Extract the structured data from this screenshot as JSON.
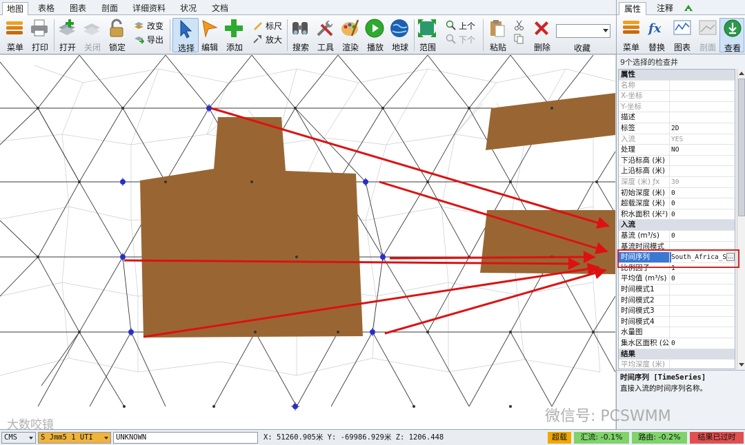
{
  "tabs": [
    "地图",
    "表格",
    "图表",
    "剖面",
    "详细资料",
    "状况",
    "文档"
  ],
  "active_tab": 0,
  "ribbon": {
    "menu": "菜单",
    "print": "打印",
    "open": "打开",
    "close": "关闭",
    "lock": "锁定",
    "change": "改变",
    "export": "导出",
    "select": "选择",
    "edit": "编辑",
    "add": "添加",
    "ruler": "标尺",
    "zoom": "放大",
    "search": "搜索",
    "tools": "工具",
    "render": "渲染",
    "play": "播放",
    "globe": "地球",
    "extent": "范围",
    "prev": "上个",
    "next": "下个",
    "paste": "粘贴",
    "delete": "删除",
    "favorites": "收藏",
    "favorites_value": ""
  },
  "panel": {
    "tab_properties": "属性",
    "tab_notes": "注释",
    "toolbar": {
      "menu": "菜单",
      "replace": "替换",
      "chart": "图表",
      "profile": "剖面",
      "inspect": "查看"
    },
    "caption": "9个选择的检查井",
    "rows": [
      {
        "k": "属性",
        "v": "",
        "type": "cat"
      },
      {
        "k": "名称",
        "v": "",
        "type": "dim"
      },
      {
        "k": "X-坐标",
        "v": "",
        "type": "dim"
      },
      {
        "k": "Y-坐标",
        "v": "",
        "type": "dim"
      },
      {
        "k": "描述",
        "v": "",
        "type": ""
      },
      {
        "k": "标签",
        "v": "2D",
        "type": ""
      },
      {
        "k": "入流",
        "v": "YES",
        "type": "dim"
      },
      {
        "k": "处理",
        "v": "NO",
        "type": ""
      },
      {
        "k": "下沿标高 (米)",
        "v": "",
        "type": ""
      },
      {
        "k": "上沿标高 (米)",
        "v": "",
        "type": ""
      },
      {
        "k": "深度 (米) ƒx",
        "v": "30",
        "type": "dim"
      },
      {
        "k": "初始深度 (米)",
        "v": "0",
        "type": ""
      },
      {
        "k": "超载深度 (米)",
        "v": "0",
        "type": ""
      },
      {
        "k": "积水面积 (米²)",
        "v": "0",
        "type": ""
      },
      {
        "k": "入流",
        "v": "",
        "type": "cat"
      },
      {
        "k": "基流 (m³/s)",
        "v": "0",
        "type": ""
      },
      {
        "k": "基流时间模式",
        "v": "",
        "type": ""
      },
      {
        "k": "时间序列",
        "v": "South_Africa_S",
        "type": "hl"
      },
      {
        "k": "比例因子",
        "v": "1",
        "type": ""
      },
      {
        "k": "平均值 (m³/s)",
        "v": "0",
        "type": ""
      },
      {
        "k": "时间模式1",
        "v": "",
        "type": ""
      },
      {
        "k": "时间模式2",
        "v": "",
        "type": ""
      },
      {
        "k": "时间模式3",
        "v": "",
        "type": ""
      },
      {
        "k": "时间模式4",
        "v": "",
        "type": ""
      },
      {
        "k": "水量图",
        "v": "",
        "type": ""
      },
      {
        "k": "集水区面积 (公顷)",
        "v": "0",
        "type": ""
      },
      {
        "k": "结果",
        "v": "",
        "type": "cat"
      },
      {
        "k": "平均深度 (米)",
        "v": "",
        "type": "dim"
      }
    ],
    "desc_title": "时间序列 [TimeSeries]",
    "desc_text": "直接入流的时间序列名称。"
  },
  "status": {
    "units": "CMS",
    "crs": "S Jmm5 1 UTI",
    "projection": "UNKNOWN",
    "coords": "X: 51260.905米  Y: -69986.929米  Z: 1206.448",
    "surcharge": "超载",
    "flow": "汇流: -0.1%",
    "routing": "路由: -0.2%",
    "result": "结果已过时"
  },
  "colors": {
    "building": "#996633",
    "arrow": "#dd1111",
    "node": "#2a2fbf",
    "surcharge_bg": "#f0a800",
    "flow_bg": "#7fd36a",
    "result_bg": "#e05050"
  },
  "watermark_left": "大数咬镜",
  "watermark_right": "微信号: PCSWMM"
}
